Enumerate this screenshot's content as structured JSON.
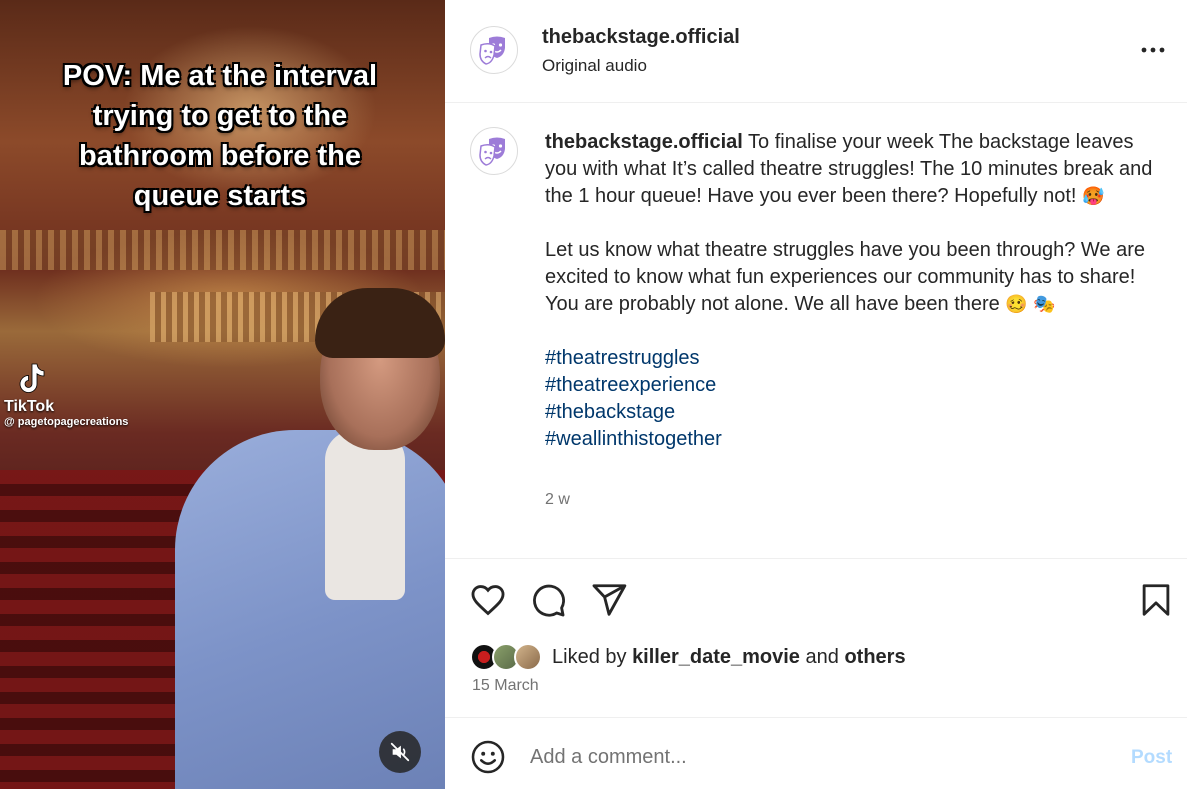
{
  "media": {
    "caption": "POV: Me at the interval trying to get to the bathroom before the queue starts",
    "watermark_name": "TikTok",
    "watermark_handle": "@ pagetopagecreations",
    "mute_icon": "speaker-muted-icon"
  },
  "header": {
    "username": "thebackstage.official",
    "audio": "Original audio",
    "more_icon": "more-horizontal-icon"
  },
  "post": {
    "username": "thebackstage.official",
    "paragraph1": "To finalise your week The backstage leaves you with what It’s called theatre struggles! The 10 minutes break and the 1 hour queue! Have you ever been there? Hopefully not!",
    "paragraph1_emoji": "🥵",
    "paragraph2": "Let us know what theatre struggles have you been through? We are excited to know what fun experiences our community has to share! You are probably not alone. We all have been there",
    "paragraph2_emoji1": "🥴",
    "paragraph2_emoji2": "🎭",
    "hashtags": [
      "#theatrestruggles",
      "#theatreexperience",
      "#thebackstage",
      "#weallinthistogether"
    ],
    "time_ago": "2 w"
  },
  "actions": {
    "icons": [
      "heart-icon",
      "comment-icon",
      "share-icon",
      "bookmark-icon"
    ],
    "liked_by_prefix": "Liked by",
    "liked_by_user": "killer_date_movie",
    "liked_by_and": "and",
    "liked_by_others": "others",
    "date": "15 March"
  },
  "comment": {
    "placeholder": "Add a comment...",
    "post_label": "Post"
  },
  "colors": {
    "hashtag": "#00376b",
    "post_button_disabled": "#b3dbff",
    "secondary_text": "#737373",
    "logo_purple": "#9d7cd8"
  }
}
